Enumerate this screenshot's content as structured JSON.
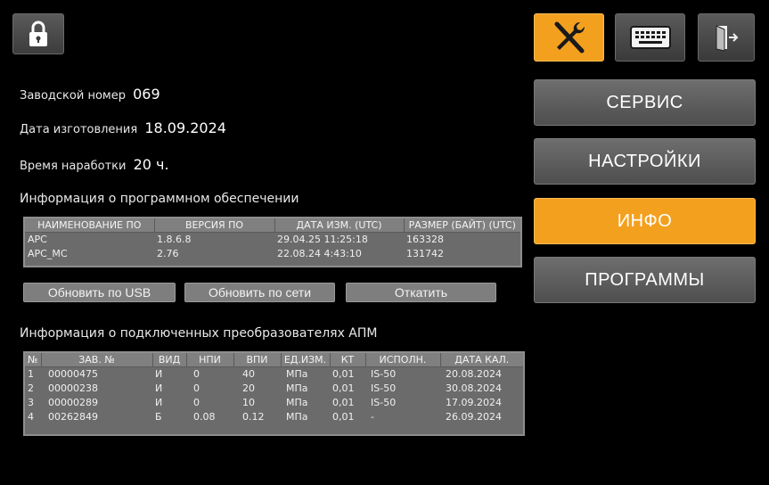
{
  "icons": {
    "lock": "lock-icon",
    "tools": "tools-icon",
    "keyboard": "keyboard-icon",
    "exit": "exit-icon"
  },
  "colors": {
    "accent": "#f4a01f",
    "panel": "#6b6b6b",
    "background": "#000000"
  },
  "info": {
    "serial_label": "Заводской номер",
    "serial_value": "069",
    "date_label": "Дата изготовления",
    "date_value": "18.09.2024",
    "hours_label": "Время наработки",
    "hours_value": "20 ч."
  },
  "software": {
    "title": "Информация о программном обеспечении",
    "headers": [
      "НАИМЕНОВАНИЕ ПО",
      "ВЕРСИЯ ПО",
      "ДАТА ИЗМ. (UTC)",
      "РАЗМЕР (БАЙТ) (UTC)"
    ],
    "rows": [
      [
        "АРС",
        "1.8.6.8",
        "29.04.25 11:25:18",
        "163328"
      ],
      [
        "APC_MC",
        "2.76",
        "22.08.24 4:43:10",
        "131742"
      ]
    ]
  },
  "update_buttons": {
    "usb": "Обновить по USB",
    "network": "Обновить по сети",
    "rollback": "Откатить"
  },
  "devices": {
    "title": "Информация о подключенных преобразователях АПМ",
    "headers": [
      "№",
      "ЗАВ. №",
      "ВИД",
      "НПИ",
      "ВПИ",
      "ЕД.ИЗМ.",
      "КТ",
      "ИСПОЛН.",
      "ДАТА КАЛ."
    ],
    "rows": [
      [
        "1",
        "00000475",
        "И",
        "0",
        "40",
        "МПа",
        "0,01",
        "IS-50",
        "20.08.2024"
      ],
      [
        "2",
        "00000238",
        "И",
        "0",
        "20",
        "МПа",
        "0,01",
        "IS-50",
        "30.08.2024"
      ],
      [
        "3",
        "00000289",
        "И",
        "0",
        "10",
        "МПа",
        "0,01",
        "IS-50",
        "17.09.2024"
      ],
      [
        "4",
        "00262849",
        "Б",
        "0.08",
        "0.12",
        "МПа",
        "0,01",
        "-",
        "26.09.2024"
      ]
    ]
  },
  "menu": {
    "service": "СЕРВИС",
    "settings": "НАСТРОЙКИ",
    "info": "ИНФО",
    "programs": "ПРОГРАММЫ",
    "active": "info"
  }
}
